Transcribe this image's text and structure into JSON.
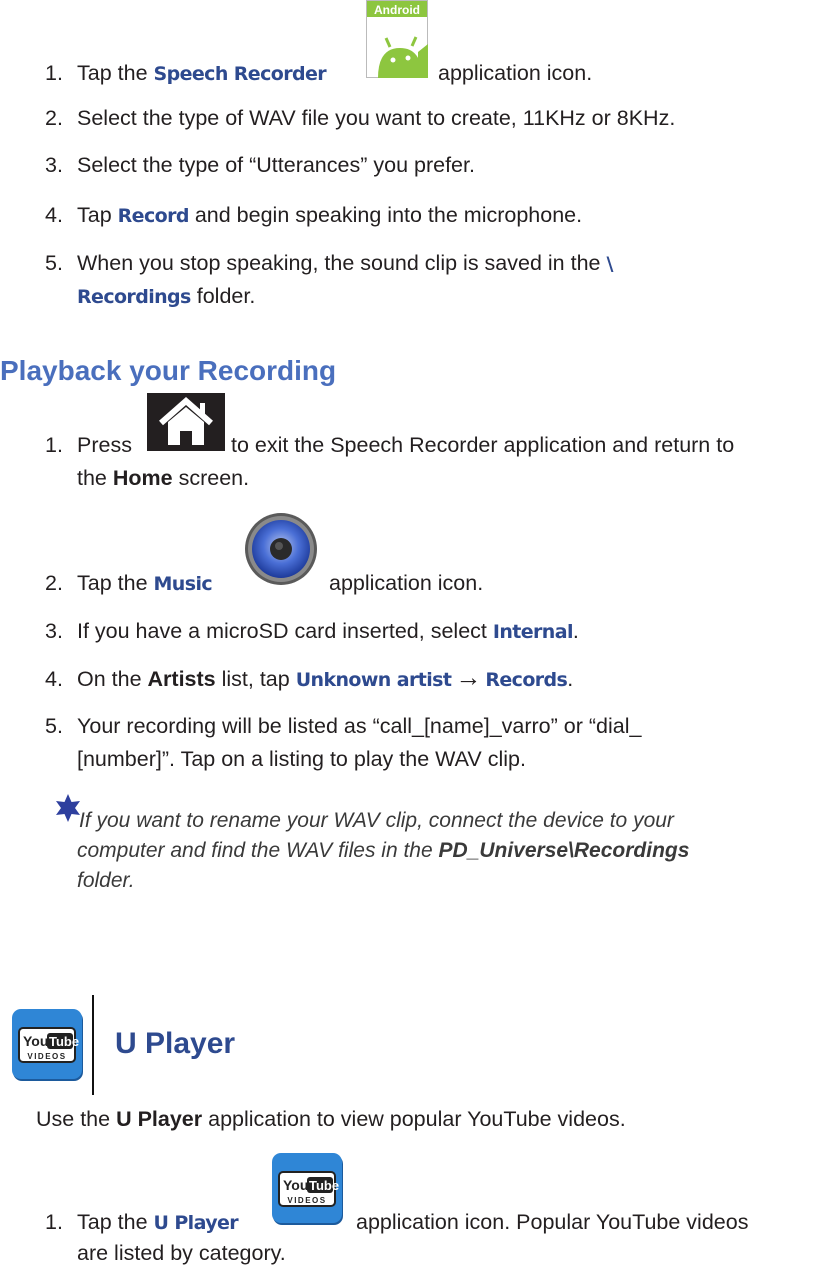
{
  "section1": {
    "steps": [
      {
        "num": "1.",
        "pre": "Tap the ",
        "kw": "Speech Recorder",
        "post": " application icon.",
        "icon": "android-app-icon",
        "icon_label": "Android"
      },
      {
        "num": "2.",
        "text": "Select the type of WAV file you want to create, 11KHz or 8KHz."
      },
      {
        "num": "3.",
        "text": "Select the type of “Utterances” you prefer."
      },
      {
        "num": "4.",
        "pre": "Tap ",
        "kw": "Record",
        "post": " and begin speaking into the microphone."
      },
      {
        "num": "5.",
        "pre": "When you stop speaking, the sound clip is saved in the ",
        "kw": "\\",
        "line2_kw": "Recordings",
        "line2_post": " folder."
      }
    ]
  },
  "playback": {
    "heading": "Playback your Recording",
    "steps": [
      {
        "num": "1.",
        "pre": "Press ",
        "post": " to exit the Speech Recorder application and return to",
        "line2_pre": "the ",
        "line2_bold": "Home",
        "line2_post": " screen.",
        "icon": "home-icon"
      },
      {
        "num": "2.",
        "pre": "Tap the ",
        "kw": "Music",
        "post": " application icon.",
        "icon": "music-speaker-icon"
      },
      {
        "num": "3.",
        "pre": "If you have a microSD card inserted, select ",
        "kw": "Internal",
        "post": "."
      },
      {
        "num": "4.",
        "pre": "On the ",
        "bold": "Artists",
        "mid": " list, tap ",
        "kw": "Unknown artist",
        "arrow": "→",
        "kw2": "Records",
        "post": "."
      },
      {
        "num": "5.",
        "text": "Your recording will be listed as “call_[name]_varro” or “dial_",
        "line2": "[number]”. Tap on a listing to play the WAV clip."
      }
    ],
    "note": {
      "icon": "star-icon",
      "line1": " If you want to rename your WAV clip, connect the device to your",
      "line2_pre": "computer and find the WAV files in the ",
      "line2_bold": "PD_Universe\\Recordings",
      "line3": "folder."
    }
  },
  "uplayer": {
    "title": "U Player",
    "icon": "youtube-videos-icon",
    "icon_you": "You",
    "icon_tube": "Tube",
    "icon_videos": "VIDEOS",
    "intro_pre": "Use the ",
    "intro_bold": "U Player",
    "intro_post": " application to view popular YouTube videos.",
    "steps": [
      {
        "num": "1.",
        "pre": "Tap the ",
        "kw": "U Player",
        "post": " application icon. Popular YouTube videos",
        "line2": "are listed by category."
      }
    ]
  },
  "colors": {
    "keyword": "#2e4a8f",
    "heading": "#4a6fbd",
    "text": "#231f20",
    "android_green": "#8dc63f",
    "youtube_blue": "#2f86d6"
  }
}
